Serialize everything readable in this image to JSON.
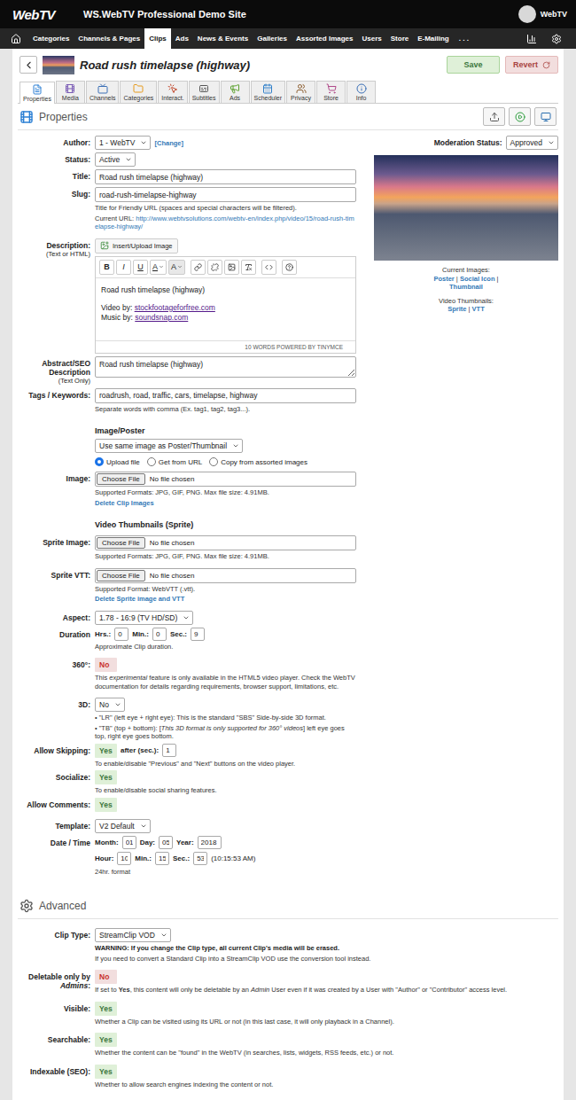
{
  "header": {
    "logo": "WebTV",
    "site": "WS.WebTV Professional Demo Site",
    "user": "WebTV"
  },
  "nav": {
    "items": [
      {
        "label": "Categories",
        "selected": false
      },
      {
        "label": "Channels & Pages",
        "selected": false
      },
      {
        "label": "Clips",
        "selected": true
      },
      {
        "label": "Ads",
        "selected": false
      },
      {
        "label": "News & Events",
        "selected": false
      },
      {
        "label": "Galleries",
        "selected": false
      },
      {
        "label": "Assorted Images",
        "selected": false
      },
      {
        "label": "Users",
        "selected": false
      },
      {
        "label": "Store",
        "selected": false
      },
      {
        "label": "E-Mailing",
        "selected": false
      }
    ],
    "more": ". . ."
  },
  "title_bar": {
    "title": "Road rush timelapse (highway)",
    "save": "Save",
    "revert": "Revert"
  },
  "tabs": [
    {
      "label": "Properties",
      "selected": true
    },
    {
      "label": "Media",
      "selected": false
    },
    {
      "label": "Channels",
      "selected": false
    },
    {
      "label": "Categories",
      "selected": false
    },
    {
      "label": "Interact.",
      "selected": false
    },
    {
      "label": "Subtitles",
      "selected": false
    },
    {
      "label": "Ads",
      "selected": false
    },
    {
      "label": "Scheduler",
      "selected": false
    },
    {
      "label": "Privacy",
      "selected": false
    },
    {
      "label": "Store",
      "selected": false
    },
    {
      "label": "Info",
      "selected": false
    }
  ],
  "properties": {
    "heading": "Properties",
    "author": {
      "label": "Author:",
      "value": "1 - WebTV",
      "link": "[Change]"
    },
    "moderation": {
      "label": "Moderation Status:",
      "value": "Approved"
    },
    "status": {
      "label": "Status:",
      "value": "Active"
    },
    "title": {
      "label": "Title:",
      "value": "Road rush timelapse (highway)"
    },
    "slug": {
      "label": "Slug:",
      "value": "road-rush-timelapse-highway",
      "help": "Title for Friendly URL (spaces and special characters will be filtered).",
      "url_label": "Current URL:",
      "url": "http://www.webtvsolutions.com/webtv-en/index.php/video/15/road-rush-timelapse-highway/"
    },
    "description": {
      "label": "Description:",
      "sublabel": "(Text or HTML)",
      "insert": "Insert/Upload Image",
      "toolbar": [
        {
          "label": "B",
          "kind": "bold"
        },
        {
          "label": "I",
          "kind": "italic"
        },
        {
          "label": "U",
          "kind": "underline"
        },
        {
          "label": "A",
          "kind": "color"
        },
        {
          "label": "A",
          "kind": "highlight"
        }
      ],
      "lines": [
        [
          {
            "text": "Road rush timelapse (highway)",
            "link": false
          }
        ],
        [
          {
            "text": "Video by: ",
            "link": false
          },
          {
            "text": "stockfootageforfree.com",
            "link": true
          }
        ],
        [
          {
            "text": "Music by: ",
            "link": false
          },
          {
            "text": "soundsnap.com",
            "link": true
          }
        ]
      ],
      "footer": "10 WORDS POWERED BY TINYMCE"
    },
    "abstract": {
      "label": "Abstract/SEO Description",
      "sublabel": "(Text Only)",
      "value": "Road rush timelapse (highway)"
    },
    "tags": {
      "label": "Tags / Keywords:",
      "value": "roadrush, road, traffic, cars, timelapse, highway",
      "help": "Separate words with comma (Ex. tag1, tag2, tag3...)."
    },
    "image_poster": {
      "heading": "Image/Poster",
      "mode": "Use same image as Poster/Thumbnail",
      "radios": [
        {
          "label": "Upload file",
          "selected": true
        },
        {
          "label": "Get from URL",
          "selected": false
        },
        {
          "label": "Copy from assorted images",
          "selected": false
        }
      ],
      "label": "Image:",
      "button": "Choose File",
      "file": "No file chosen",
      "help": "Supported Formats: JPG, GIF, PNG. Max file size: 4.91MB.",
      "link": "Delete Clip Images"
    },
    "sprite": {
      "heading": "Video Thumbnails (Sprite)",
      "image": {
        "label": "Sprite Image:",
        "button": "Choose File",
        "file": "No file chosen",
        "help": "Supported Formats: JPG, GIF, PNG. Max file size: 4.91MB."
      },
      "vtt": {
        "label": "Sprite VTT:",
        "button": "Choose File",
        "file": "No file chosen",
        "help": "Supported Format: WebVTT (.vtt).",
        "link": "Delete Sprite image and VTT"
      }
    },
    "aspect": {
      "label": "Aspect:",
      "value": "1.78 - 16:9 (TV HD/SD)"
    },
    "duration": {
      "label": "Duration",
      "fields": [
        {
          "label": "Hrs.:",
          "value": "0"
        },
        {
          "label": "Min.:",
          "value": "0"
        },
        {
          "label": "Sec.:",
          "value": "9"
        }
      ],
      "help": "Approximate Clip duration."
    },
    "vr360": {
      "label": "360°:",
      "toggle": {
        "text": "No",
        "on": false
      },
      "help": [
        {
          "text": "This ",
          "italic": false
        },
        {
          "text": "experimental",
          "italic": true
        },
        {
          "text": " feature is only available in the HTML5 video player. Check the WebTV documentation for details regarding requirements, browser support, limitations, etc.",
          "italic": false
        }
      ]
    },
    "stereo": {
      "label": "3D:",
      "value": "No",
      "bullets": [
        [
          {
            "text": "• \"LR\" (left eye + right eye): This is the standard \"SBS\" Side-by-side 3D format.",
            "italic": false
          }
        ],
        [
          {
            "text": "• \"TB\" (top + bottom): [",
            "italic": false
          },
          {
            "text": "This 3D format is only supported for 360° videos",
            "italic": true
          },
          {
            "text": "] left eye goes top, right eye goes bottom.",
            "italic": false
          }
        ]
      ]
    },
    "skipping": {
      "label": "Allow Skipping:",
      "toggle": {
        "text": "Yes",
        "on": true
      },
      "after": "after (sec.):",
      "value": "1",
      "help": "To enable/disable \"Previous\" and \"Next\" buttons on the video player."
    },
    "socialize": {
      "label": "Socialize:",
      "toggle": {
        "text": "Yes",
        "on": true
      },
      "help": "To enable/disable social sharing features."
    },
    "comments": {
      "label": "Allow Comments:",
      "toggle": {
        "text": "Yes",
        "on": true
      }
    },
    "template": {
      "label": "Template:",
      "value": "V2 Default"
    },
    "datetime": {
      "label": "Date / Time",
      "rows": [
        [
          {
            "label": "Month:",
            "value": "01"
          },
          {
            "label": "Day:",
            "value": "05"
          },
          {
            "label": "Year:",
            "value": "2018"
          }
        ],
        [
          {
            "label": "Hour:",
            "value": "10"
          },
          {
            "label": "Min.:",
            "value": "15"
          },
          {
            "label": "Sec.:",
            "value": "53"
          }
        ]
      ],
      "readout": "(10:15:53 AM)",
      "help": "24hr. format"
    },
    "side": {
      "current": "Current Images:",
      "current_links": [
        "Poster",
        "Social Icon",
        "Thumbnail"
      ],
      "thumbs": "Video Thumbnails:",
      "thumb_links": [
        "Sprite",
        "VTT"
      ],
      "separator": " | "
    }
  },
  "advanced": {
    "heading": "Advanced",
    "rows": [
      {
        "kind": "select",
        "label": [
          {
            "text": "Clip Type:",
            "italic": false
          }
        ],
        "value": "StreamClip VOD",
        "warning": "WARNING: If you change the Clip type, all current Clip's media will be erased.",
        "help": "If you need to convert a Standard Clip into a StreamClip VOD use the conversion tool instead."
      },
      {
        "kind": "toggle",
        "label": [
          {
            "text": "Deletable only by ",
            "italic": false
          },
          {
            "text": "Admins",
            "italic": true
          },
          {
            "text": ":",
            "italic": false
          }
        ],
        "toggle": {
          "text": "No",
          "on": false
        },
        "help": [
          {
            "text": "If set to ",
            "italic": false
          },
          {
            "text": "Yes",
            "italic": false,
            "bold": true
          },
          {
            "text": ", this content will only be deletable by an ",
            "italic": false
          },
          {
            "text": "Admin",
            "italic": true
          },
          {
            "text": " User even if it was created by a User with \"Author\" or \"Contributor\" access level.",
            "italic": false
          }
        ]
      },
      {
        "kind": "toggle",
        "label": [
          {
            "text": "Visible:",
            "italic": false
          }
        ],
        "toggle": {
          "text": "Yes",
          "on": true
        },
        "help": "Whether a Clip can be visited using its URL or not (in this last case, it will only playback in a Channel)."
      },
      {
        "kind": "toggle",
        "label": [
          {
            "text": "Searchable:",
            "italic": false
          }
        ],
        "toggle": {
          "text": "Yes",
          "on": true
        },
        "help": "Whether the content can be \"found\" in the WebTV (in searches, lists, widgets, RSS feeds, etc.) or not."
      },
      {
        "kind": "toggle",
        "label": [
          {
            "text": "Indexable (SEO):",
            "italic": false
          }
        ],
        "toggle": {
          "text": "Yes",
          "on": true
        },
        "help": "Whether to allow search engines indexing the content or not."
      }
    ]
  }
}
